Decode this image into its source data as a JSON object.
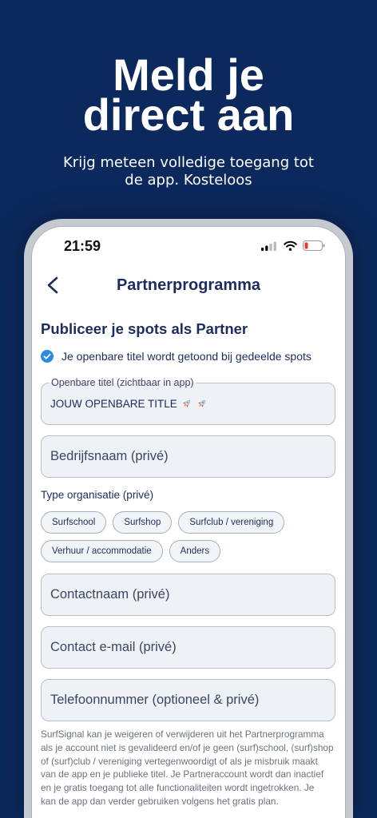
{
  "colors": {
    "background": "#0c295d",
    "phone_frame": "#c6cad0",
    "text_primary": "#1d2c5a",
    "accent": "#2d8ae3",
    "field_fill": "#eef1f5",
    "battery_low": "#e53935"
  },
  "promo": {
    "title": "Meld je direct aan",
    "subtitle": "Krijg meteen volledige toegang tot de app. Kosteloos"
  },
  "status_bar": {
    "time": "21:59",
    "signal_icon": "cellular-signal-icon",
    "wifi_icon": "wifi-icon",
    "battery_icon": "battery-low-icon"
  },
  "nav": {
    "back_icon": "chevron-left-icon",
    "title": "Partnerprogramma"
  },
  "form": {
    "heading": "Publiceer je spots als Partner",
    "notice": {
      "icon": "check-circle-icon",
      "text": "Je openbare titel wordt getoond bij gedeelde spots"
    },
    "public_title": {
      "label": "Openbare titel (zichtbaar in app)",
      "value": "JOUW OPENBARE TITLE",
      "value_icons": [
        "rocket-icon",
        "rocket-icon"
      ]
    },
    "company_name": {
      "placeholder": "Bedrijfsnaam (privé)"
    },
    "organisation_type": {
      "label": "Type organisatie (privé)",
      "options": [
        "Surfschool",
        "Surfshop",
        "Surfclub / vereniging",
        "Verhuur / accommodatie",
        "Anders"
      ]
    },
    "contact_name": {
      "placeholder": "Contactnaam (privé)"
    },
    "contact_email": {
      "placeholder": "Contact e-mail (privé)"
    },
    "phone": {
      "placeholder": "Telefoonnummer (optioneel & privé)"
    },
    "disclaimer_lines": [
      "SurfSignal kan je weigeren of verwijderen uit het Partnerprogramma",
      "als je account niet is gevalideerd en/of je geen (surf)school, (surf)shop",
      "of (surf)club / vereniging vertegenwoordigt of als je misbruik maakt",
      "van de app en je publieke titel. Je Partneraccount wordt dan inactief",
      "en je gratis toegang tot alle functionaliteiten wordt ingetrokken. Je",
      "kan de app dan verder gebruiken volgens het gratis plan."
    ]
  }
}
